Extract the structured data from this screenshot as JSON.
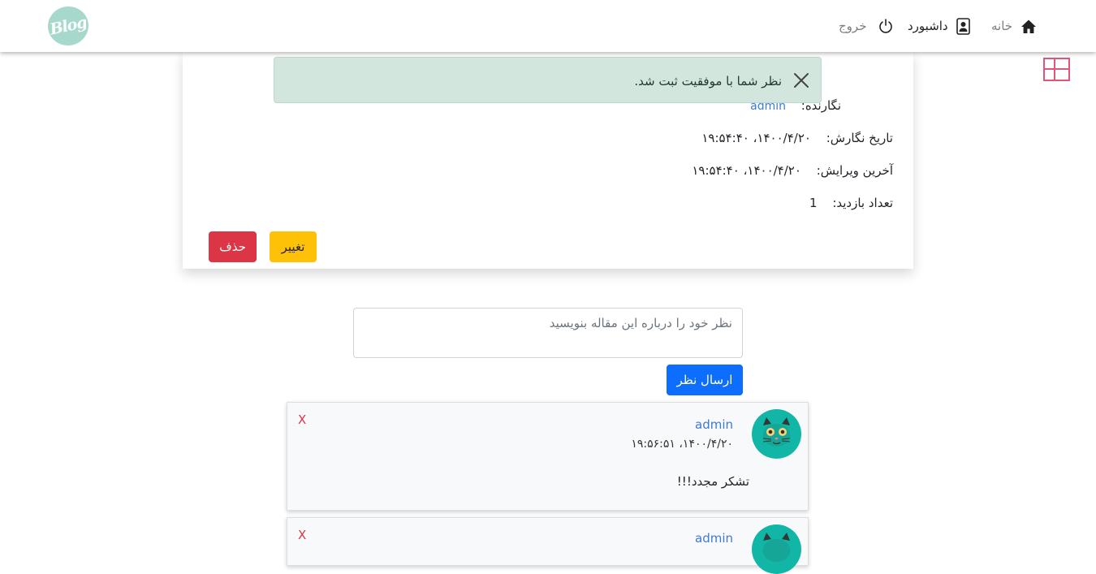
{
  "navbar": {
    "logo_text": "Blog",
    "home_label": "خانه",
    "dashboard_label": "داشبورد",
    "logout_label": "خروج"
  },
  "alert": {
    "message": "نظر شما با موفقیت ثبت شد."
  },
  "post_meta": {
    "author_label": "نگارنده:",
    "author_value": "admin",
    "created_label": "تاریخ نگارش:",
    "created_value": "۱۴۰۰/۴/۲۰، ۱۹:۵۴:۴۰",
    "edited_label": "آخرین ویرایش:",
    "edited_value": "۱۴۰۰/۴/۲۰، ۱۹:۵۴:۴۰",
    "views_label": "تعداد بازدید:",
    "views_value": "1"
  },
  "actions": {
    "edit_label": "تغییر",
    "delete_label": "حذف"
  },
  "comment_form": {
    "placeholder": "نظر خود را درباره این مقاله بنویسید",
    "submit_label": "ارسال نظر"
  },
  "comments": [
    {
      "author": "admin",
      "date": "۱۴۰۰/۴/۲۰، ۱۹:۵۶:۵۱",
      "text": "تشکر مجدد!!!",
      "delete_label": "X"
    },
    {
      "author": "admin",
      "delete_label": "X"
    }
  ],
  "colors": {
    "primary": "#0d6efd",
    "warning": "#ffc107",
    "danger": "#dc3545",
    "alert_bg": "#d2e6dd",
    "link": "#3d7ad5",
    "avatar_bg": "#12b6a6",
    "logo_bg": "#a6d9cb"
  },
  "icons": [
    "home-icon",
    "contact-card-icon",
    "power-icon",
    "close-icon",
    "layout-grid-icon",
    "cat-avatar-icon"
  ]
}
